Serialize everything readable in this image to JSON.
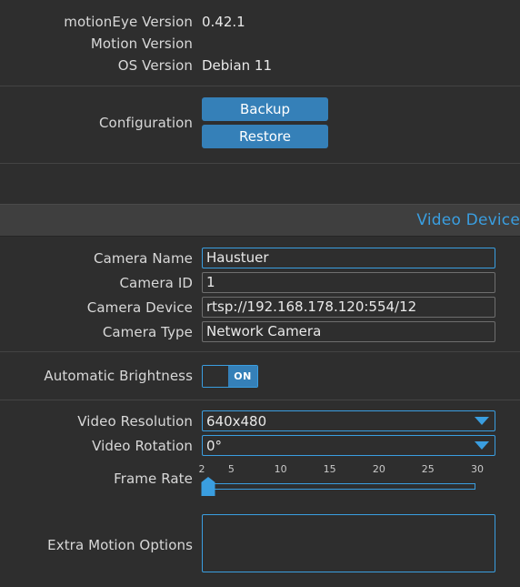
{
  "theme": {
    "background": "#2e2e2e",
    "section_bar_background": "#3f3f3f",
    "accent_blue": "#3a9ee0",
    "button_blue": "#3580b8",
    "text": "#e8e8e8",
    "divider": "#444444"
  },
  "version_info": {
    "rows": [
      {
        "label": "motionEye Version",
        "value": "0.42.1"
      },
      {
        "label": "Motion Version",
        "value": ""
      },
      {
        "label": "OS Version",
        "value": "Debian 11"
      }
    ]
  },
  "configuration": {
    "label": "Configuration",
    "backup_label": "Backup",
    "restore_label": "Restore"
  },
  "video_device_section": {
    "title": "Video Device",
    "fields": [
      {
        "label": "Camera Name",
        "value": "Haustuer",
        "focused": true
      },
      {
        "label": "Camera ID",
        "value": "1",
        "focused": false
      },
      {
        "label": "Camera Device",
        "value": "rtsp://192.168.178.120:554/12",
        "focused": false
      },
      {
        "label": "Camera Type",
        "value": "Network Camera",
        "focused": false
      }
    ],
    "automatic_brightness": {
      "label": "Automatic Brightness",
      "state": "ON"
    },
    "video_resolution": {
      "label": "Video Resolution",
      "value": "640x480"
    },
    "video_rotation": {
      "label": "Video Rotation",
      "value": "0°"
    },
    "frame_rate": {
      "label": "Frame Rate",
      "value": 2,
      "min": 2,
      "max": 30,
      "ticks": [
        {
          "label": "2",
          "pos": 0
        },
        {
          "label": "5",
          "pos": 10.7
        },
        {
          "label": "10",
          "pos": 28.6
        },
        {
          "label": "15",
          "pos": 46.4
        },
        {
          "label": "20",
          "pos": 64.3
        },
        {
          "label": "25",
          "pos": 82.1
        },
        {
          "label": "30",
          "pos": 100
        }
      ]
    },
    "extra_motion_options": {
      "label": "Extra Motion Options",
      "value": "",
      "placeholder": ""
    }
  }
}
